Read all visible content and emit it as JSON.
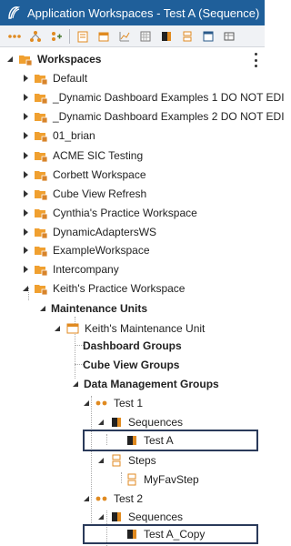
{
  "window": {
    "title": "Application Workspaces - Test A (Sequence)"
  },
  "toolbar": {
    "buttons": [
      {
        "icon": "collapse-icon"
      },
      {
        "icon": "hierarchy-icon"
      },
      {
        "icon": "add-node-icon"
      },
      {
        "icon": "document-icon"
      },
      {
        "icon": "calendar-icon"
      },
      {
        "icon": "chart-icon"
      },
      {
        "icon": "grid-icon"
      },
      {
        "icon": "sequence-icon"
      },
      {
        "icon": "step-icon"
      },
      {
        "icon": "window-icon"
      },
      {
        "icon": "table-icon"
      }
    ]
  },
  "tree": {
    "root_label": "Workspaces",
    "workspaces": [
      "Default",
      "_Dynamic Dashboard Examples 1 DO NOT EDI",
      "_Dynamic Dashboard Examples 2 DO NOT EDI",
      "01_brian",
      "ACME SIC Testing",
      "Corbett Workspace",
      "Cube View Refresh",
      "Cynthia's Practice Workspace",
      "DynamicAdaptersWS",
      "ExampleWorkspace",
      "Intercompany"
    ],
    "expanded_workspace": "Keith's Practice Workspace",
    "maintenance_units_label": "Maintenance Units",
    "maintenance_unit": "Keith's Maintenance Unit",
    "dashboard_groups": "Dashboard Groups",
    "cube_view_groups": "Cube View Groups",
    "data_management_groups": "Data Management Groups",
    "test1": "Test 1",
    "sequences1": "Sequences",
    "test_a": "Test A",
    "steps": "Steps",
    "myfavstep": "MyFavStep",
    "test2": "Test 2",
    "sequences2": "Sequences",
    "test_a_copy": "Test A_Copy"
  },
  "colors": {
    "titlebar": "#1f5f9a",
    "folder": "#f0a030",
    "selected_border": "#2a3a5a"
  }
}
